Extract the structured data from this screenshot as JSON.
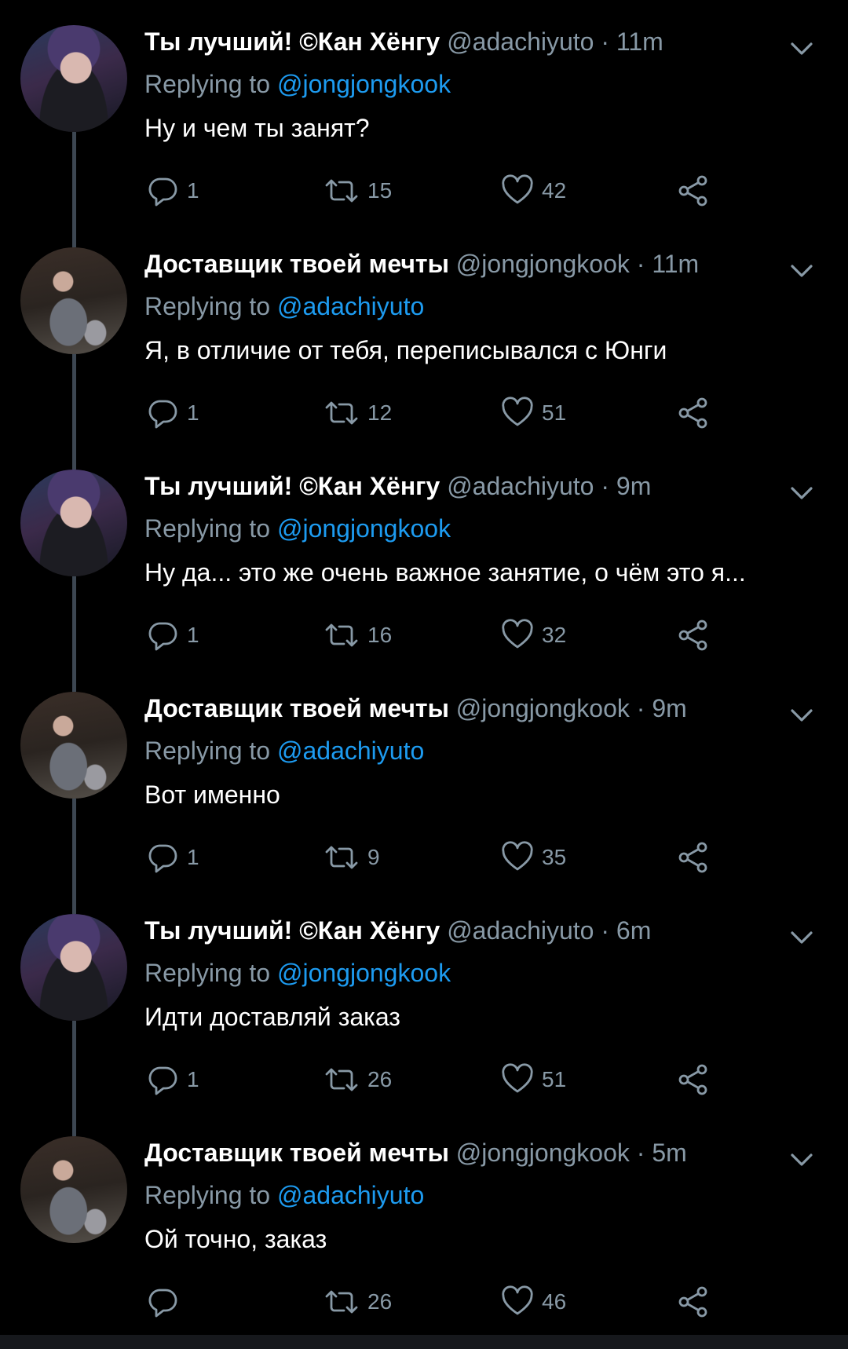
{
  "tweets": [
    {
      "name": "Ты лучший! ©Кан Хёнгу",
      "handle": "@adachiyuto",
      "time": "11m",
      "replying_prefix": "Replying to",
      "replying_to": "@jongjongkook",
      "text": "Ну и чем ты занят?",
      "replies": "1",
      "retweets": "15",
      "likes": "42"
    },
    {
      "name": "Доставщик твоей мечты",
      "handle": "@jongjongkook",
      "time": "11m",
      "replying_prefix": "Replying to",
      "replying_to": "@adachiyuto",
      "text": "Я, в отличие от тебя, переписывался с Юнги",
      "replies": "1",
      "retweets": "12",
      "likes": "51"
    },
    {
      "name": "Ты лучший! ©Кан Хёнгу",
      "handle": "@adachiyuto",
      "time": "9m",
      "replying_prefix": "Replying to",
      "replying_to": "@jongjongkook",
      "text": "Ну да... это же очень важное занятие, о чём это я...",
      "replies": "1",
      "retweets": "16",
      "likes": "32"
    },
    {
      "name": "Доставщик твоей мечты",
      "handle": "@jongjongkook",
      "time": "9m",
      "replying_prefix": "Replying to",
      "replying_to": "@adachiyuto",
      "text": "Вот именно",
      "replies": "1",
      "retweets": "9",
      "likes": "35"
    },
    {
      "name": "Ты лучший! ©Кан Хёнгу",
      "handle": "@adachiyuto",
      "time": "6m",
      "replying_prefix": "Replying to",
      "replying_to": "@jongjongkook",
      "text": "Идти доставляй заказ",
      "replies": "1",
      "retweets": "26",
      "likes": "51"
    },
    {
      "name": "Доставщик твоей мечты",
      "handle": "@jongjongkook",
      "time": "5m",
      "replying_prefix": "Replying to",
      "replying_to": "@adachiyuto",
      "text": "Ой точно, заказ",
      "replies": "",
      "retweets": "26",
      "likes": "46"
    }
  ],
  "separator": "·",
  "colors": {
    "background": "#000000",
    "secondary_text": "#8899a6",
    "mention": "#1d9bf0",
    "thread_line": "#3d4752"
  },
  "icons": {
    "reply": "reply-icon",
    "retweet": "retweet-icon",
    "like": "heart-icon",
    "share": "share-icon",
    "more": "chevron-down-icon"
  }
}
